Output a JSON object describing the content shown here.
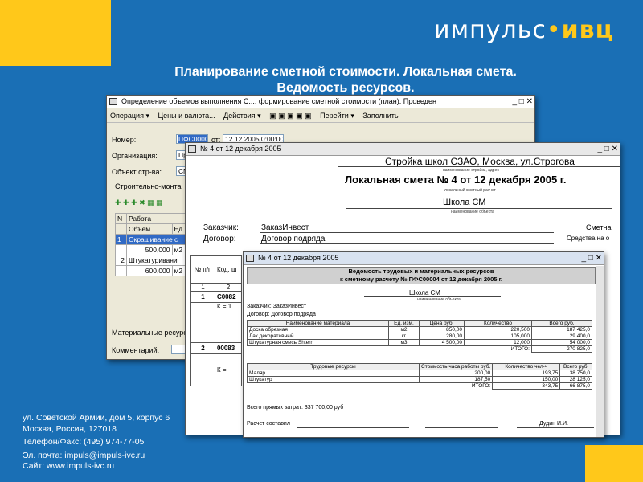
{
  "brand": {
    "logo_main": "импульс",
    "logo_dot": "•",
    "logo_suffix": "ивц"
  },
  "heading": {
    "line1": "Планирование сметной стоимости. Локальная смета.",
    "line2": "Ведомость ресурсов."
  },
  "footer": {
    "address1": "ул. Советской Армии, дом 5, корпус 6",
    "address2": "Москва, Россия, 127018",
    "phone": "Телефон/Факс: (495) 974-77-05",
    "email": "Эл. почта: impuls@impuls-ivc.ru",
    "site": "Сайт: www.impuls-ivc.ru"
  },
  "win1": {
    "title": "Определение объемов выполнения С...: формирование сметной стоимости (план). Проведен",
    "toolbar": [
      "Операция ▾",
      "Цены и валюта...",
      "Действия ▾",
      "Перейти ▾",
      "Заполнить"
    ],
    "labels": {
      "number": "Номер:",
      "org": "Организация:",
      "object": "Объект стр-ва:",
      "section": "Строительно-монта",
      "resources": "Материальные ресурс",
      "comment": "Комментарий:",
      "date_prefix": "от:"
    },
    "values": {
      "number": "ПФС00004",
      "date": "12.12.2005  0:00:00",
      "org": "Пр",
      "object": "СМ"
    },
    "grid_header": {
      "n": "N",
      "work": "Работа",
      "volume": "Объем",
      "unit": "Ед."
    },
    "rows": [
      {
        "n": "1",
        "name": "Окрашивание с",
        "volume": "500,000",
        "unit": "м2"
      },
      {
        "n": "2",
        "name": "Штукатуривани",
        "volume": "600,000",
        "unit": "м2"
      }
    ]
  },
  "win2": {
    "title": "№ 4 от 12 декабря 2005",
    "site": "Стройка школ СЗАО, Москва, ул.Строгова",
    "site_caption": "наименование стройки, адрес",
    "doc_title": "Локальная смета № 4 от 12 декабря 2005 г.",
    "doc_caption": "локальный сметный расчет",
    "object": "Школа СМ",
    "object_caption": "наименование объекта",
    "customer_label": "Заказчик:",
    "customer": "ЗаказИнвест",
    "contract_label": "Договор:",
    "contract": "Договор подряда",
    "right1": "Сметна",
    "right2": "Средства на о",
    "table_head": [
      "№ п/п",
      "Код, ш"
    ],
    "table_rows": [
      "1",
      "2",
      "1",
      "С0082",
      "К = 1",
      "2",
      "00083",
      "К ="
    ]
  },
  "win3": {
    "title": "№ 4 от 12 декабря 2005",
    "banner1": "Ведомость трудовых и материальных ресурсов",
    "banner2": "к сметному расчету № ПФС00004 от 12 декабря 2005 г.",
    "object": "Школа СМ",
    "object_caption": "наименование объекта",
    "customer": "Заказчик: ЗаказИнвест",
    "contract": "Договор: Договор подряда",
    "mat_head": [
      "Наименование материала",
      "Ед. изм.",
      "Цена руб.",
      "Количество",
      "Всего руб."
    ],
    "materials": [
      [
        "Доска обрезная",
        "м2",
        "850,00",
        "220,500",
        "187 425,0"
      ],
      [
        "Лак декоративный",
        "кг",
        "280,00",
        "105,000",
        "29 400,0"
      ],
      [
        "Штукатурная смесь Shtern",
        "м3",
        "4 500,00",
        "12,000",
        "54 000,0"
      ]
    ],
    "mat_total_label": "ИТОГО:",
    "mat_total": "270 825,0",
    "lab_head": [
      "Трудовые ресурсы",
      "Стоимость часа работы руб.",
      "Количество чел-ч",
      "Всего руб."
    ],
    "labour": [
      [
        "Маляр",
        "200,00",
        "193,75",
        "38 750,0"
      ],
      [
        "Штукатур",
        "187,50",
        "150,00",
        "28 125,0"
      ]
    ],
    "lab_total_label": "ИТОГО:",
    "lab_total_qty": "343,75",
    "lab_total": "66 875,0",
    "direct": "Всего прямых затрат: 337 700,00 руб",
    "made_by": "Расчет составил",
    "signer": "Дудин И.И."
  }
}
